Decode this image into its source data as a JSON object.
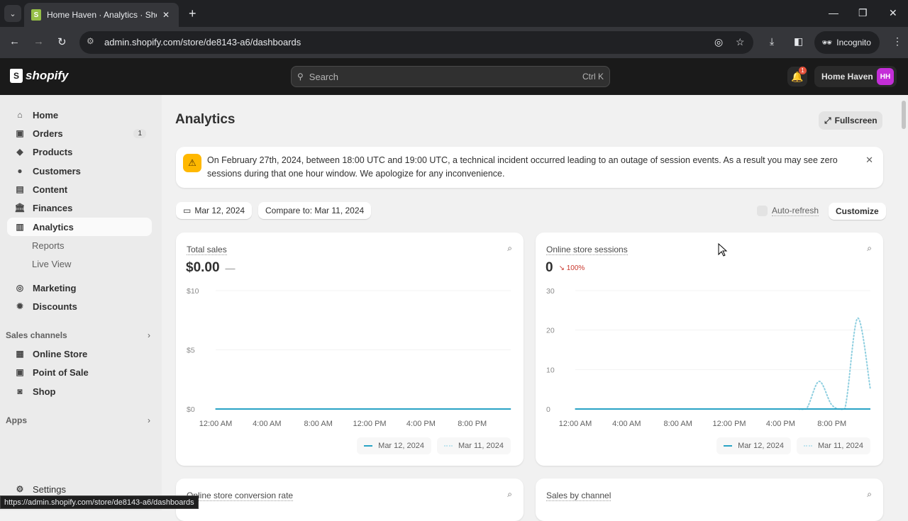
{
  "browser": {
    "tab_title": "Home Haven · Analytics · Shopify",
    "url": "admin.shopify.com/store/de8143-a6/dashboards",
    "profile_label": "Incognito",
    "status_url": "https://admin.shopify.com/store/de8143-a6/dashboards"
  },
  "topbar": {
    "logo_text": "shopify",
    "search_placeholder": "Search",
    "search_shortcut": "Ctrl K",
    "notification_count": "1",
    "store_name": "Home Haven",
    "avatar_initials": "HH"
  },
  "sidebar": {
    "items": [
      {
        "label": "Home",
        "icon": "home-icon"
      },
      {
        "label": "Orders",
        "icon": "inbox-icon",
        "badge": "1"
      },
      {
        "label": "Products",
        "icon": "tag-icon"
      },
      {
        "label": "Customers",
        "icon": "person-icon"
      },
      {
        "label": "Content",
        "icon": "content-icon"
      },
      {
        "label": "Finances",
        "icon": "bank-icon"
      },
      {
        "label": "Analytics",
        "icon": "bar-chart-icon",
        "active": true
      },
      {
        "label": "Reports"
      },
      {
        "label": "Live View"
      },
      {
        "label": "Marketing",
        "icon": "target-icon"
      },
      {
        "label": "Discounts",
        "icon": "discount-icon"
      }
    ],
    "sales_channels_label": "Sales channels",
    "channels": [
      {
        "label": "Online Store",
        "icon": "store-icon"
      },
      {
        "label": "Point of Sale",
        "icon": "pos-icon"
      },
      {
        "label": "Shop",
        "icon": "shop-icon"
      }
    ],
    "apps_label": "Apps",
    "settings_label": "Settings"
  },
  "main": {
    "title": "Analytics",
    "fullscreen_label": "Fullscreen",
    "banner_text": "On February 27th, 2024, between 18:00 UTC and 19:00 UTC, a technical incident occurred leading to an outage of session events. As a result you may see zero sessions during that one hour window. We apologize for any inconvenience.",
    "date_label": "Mar 12, 2024",
    "compare_label": "Compare to: Mar 11, 2024",
    "auto_refresh_label": "Auto-refresh",
    "customize_label": "Customize",
    "lower_cards": [
      "Online store conversion rate",
      "Sales by channel"
    ]
  },
  "chart_data": [
    {
      "type": "line",
      "title": "Total sales",
      "headline": "$0.00",
      "headline_delta": "—",
      "x": [
        "12:00 AM",
        "4:00 AM",
        "8:00 AM",
        "12:00 PM",
        "4:00 PM",
        "8:00 PM"
      ],
      "y_ticks": [
        "$10",
        "$5",
        "$0"
      ],
      "ylim": [
        0,
        10
      ],
      "series": [
        {
          "name": "Mar 12, 2024",
          "style": "solid",
          "color": "#29a3c5",
          "values": [
            0,
            0,
            0,
            0,
            0,
            0,
            0,
            0,
            0,
            0,
            0,
            0,
            0,
            0,
            0,
            0,
            0,
            0,
            0,
            0,
            0,
            0,
            0,
            0
          ]
        },
        {
          "name": "Mar 11, 2024",
          "style": "dotted",
          "color": "#bfe4ee",
          "values": [
            0,
            0,
            0,
            0,
            0,
            0,
            0,
            0,
            0,
            0,
            0,
            0,
            0,
            0,
            0,
            0,
            0,
            0,
            0,
            0,
            0,
            0,
            0,
            0
          ]
        }
      ]
    },
    {
      "type": "line",
      "title": "Online store sessions",
      "headline": "0",
      "headline_delta": "100%",
      "x": [
        "12:00 AM",
        "4:00 AM",
        "8:00 AM",
        "12:00 PM",
        "4:00 PM",
        "8:00 PM"
      ],
      "y_ticks": [
        "30",
        "20",
        "10",
        "0"
      ],
      "ylim": [
        0,
        30
      ],
      "series": [
        {
          "name": "Mar 12, 2024",
          "style": "solid",
          "color": "#29a3c5",
          "values": [
            0,
            0,
            0,
            0,
            0,
            0,
            0,
            0,
            0,
            0,
            0,
            0,
            0,
            0,
            0,
            0,
            0,
            0,
            0,
            0,
            0,
            0,
            0,
            0
          ]
        },
        {
          "name": "Mar 11, 2024",
          "style": "dotted",
          "color": "#bfe4ee",
          "values": [
            0,
            0,
            0,
            0,
            0,
            0,
            0,
            0,
            0,
            0,
            0,
            0,
            0,
            0,
            0,
            0,
            0,
            0,
            0,
            7,
            1,
            0,
            23,
            5
          ]
        }
      ]
    }
  ]
}
